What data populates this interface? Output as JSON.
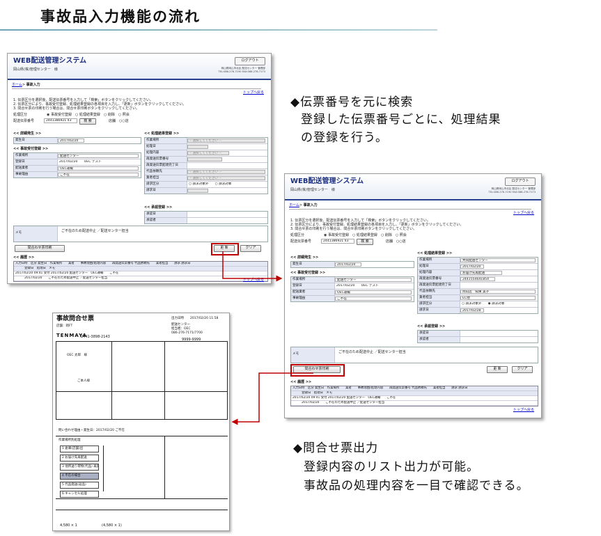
{
  "page": {
    "title": "事故品入力機能の流れ"
  },
  "colors": {
    "accent_rule": "#6fa5b4",
    "header_blue": "#1b2f80",
    "highlight_red": "#c00000"
  },
  "bullets": [
    {
      "heading": "◆伝票番号を元に検索",
      "lines": [
        "登録した伝票番号ごとに、処理結果",
        "の登録を行う。"
      ]
    },
    {
      "heading": "◆問合せ票出力",
      "lines": [
        "登録内容のリスト出力が可能。",
        "事故品の処理内容を一目で確認できる。"
      ]
    }
  ],
  "app": {
    "name": "WEB配送管理システム",
    "center": "岡山県(株)管理センター　様",
    "logout": "ログアウト",
    "address": [
      "岡山県岡山市北区 配送センター 管理部",
      "TEL:086-276-7190  FAX:086-276-7173"
    ],
    "breadcrumb_home": "ホーム",
    "breadcrumb_current": "事故入力",
    "top_link": "トップへ戻る",
    "instructions": [
      "1. 伝票区分を選択後、配送伝票番号を入力して「検索」ボタンをクリックしてください。",
      "2. 伝票区分により、事故受付登録、処理結果登録の各項目を入力し、「更新」ボタンをクリックしてください。",
      "3. 問合せ票の印刷を行う場合は、問合せ票印刷ボタンをクリックしてください。"
    ],
    "type_label": "処理区分",
    "radio_options": [
      "事故受付登録",
      "処理結果登録",
      "削除",
      "照会"
    ],
    "slip_label": "配送伝票番号",
    "slip_value": "2441386921 43",
    "search_button": "検 索",
    "store_label": "店舗",
    "store_value": "○○店",
    "sec_occur": "<< 詳細発生 >>",
    "occur_label": "発生日",
    "occur_value": "2017/02/20",
    "sec_accept": "<< 事故受付登録 >>",
    "accept_fields": [
      {
        "label": "作業場所",
        "value": "配送センター"
      },
      {
        "label": "登録日",
        "value": "2017/02/20　　OEC テスト"
      },
      {
        "label": "配送業者",
        "value": "OEC運輸"
      },
      {
        "label": "事故理由",
        "value": "ご不在"
      }
    ],
    "sec_result": "<< 処理結果登録 >>",
    "result_fields_1": [
      {
        "label": "作業場所",
        "value": "-- 選択してください --"
      },
      {
        "label": "処理日",
        "value": ""
      },
      {
        "label": "処理内容",
        "value": "-- 選択してください --"
      },
      {
        "label": "再発送伝票番号",
        "value": ""
      },
      {
        "label": "再発送伝票配達完了日",
        "value": ""
      },
      {
        "label": "代品依頼先",
        "value": "-- 選択してください --"
      },
      {
        "label": "業者担当",
        "value": "-- 選択してください --"
      },
      {
        "label": "請求区分",
        "value": "○ 請求対象外　　○ 請求対象"
      },
      {
        "label": "請求日",
        "value": ""
      }
    ],
    "result_fields_2": [
      {
        "label": "作業場所",
        "value": "共同配送センター"
      },
      {
        "label": "処理日",
        "value": "2017/02/20"
      },
      {
        "label": "処理内容",
        "value": "お届け先再配送"
      },
      {
        "label": "再発送伝票番号",
        "value": "2441554641854"
      },
      {
        "label": "再発送伝票配達完了日",
        "value": ""
      },
      {
        "label": "代品依頼先",
        "value": "岡山店　知東 美子"
      },
      {
        "label": "業者担当",
        "value": "EC他"
      },
      {
        "label": "請求区分",
        "value": "○ 請求対象外　　◉ 請求対象"
      },
      {
        "label": "請求日",
        "value": "2017/02/28"
      }
    ],
    "sec_approval": "<< 承認登録 >>",
    "approval_fields": [
      {
        "label": "承認日",
        "value": ""
      },
      {
        "label": "承認者",
        "value": ""
      }
    ],
    "memo_label": "メモ",
    "memo_value": "ご不在のため配送中止 ／配送センター担当",
    "print_button": "問合わせ票印刷",
    "update_button": "更 新",
    "clear_button": "クリア",
    "sec_history": "<< 履歴 >>",
    "history_header": "入力日時　区分 発生日　作業場所　　業者　　事故理由/処理内容　　再発送伝票番号 代品依頼先　　業者担当　　請求 請求日",
    "history_subheader": "　　　登録日　処理日　メモ",
    "history_rows": [
      "2017/02/20 09:41 受付 2017/02/20 配送センター　OEC運輸　　ご不在",
      "　　　2017/02/20　　ご不在のため配送中止 ／配送センター担当"
    ]
  },
  "inquiry": {
    "title": "事故問合せ票",
    "printed": "出力日時　　2017/02/20 11:58",
    "store": "店舗：岡FT",
    "reception_lines": [
      "配送センター",
      "担当者：OEC",
      "086-276-7171/7700"
    ],
    "brand": "TENMAYA",
    "slip_no": "2441-3898-2143",
    "phone": "9999-9999",
    "customer": "OEC 太郎　様",
    "customer_right": "ご本人様",
    "reason_header": "問い合わせ理由・発生日：2017/02/20 ご不在",
    "flow_header": "作業場所別処理",
    "flow_steps": [
      "1 倉庫(店舗)出",
      "2 お届け先再配送",
      "3 他所送り荷物(代品) 再発送",
      "4 不在の場合",
      "5 代品発送(返品)",
      "6 キャンセル処理"
    ],
    "flow_active_step": 3,
    "amount_1": "4,580 × 1",
    "amount_2": "(4,580 × 1)"
  }
}
